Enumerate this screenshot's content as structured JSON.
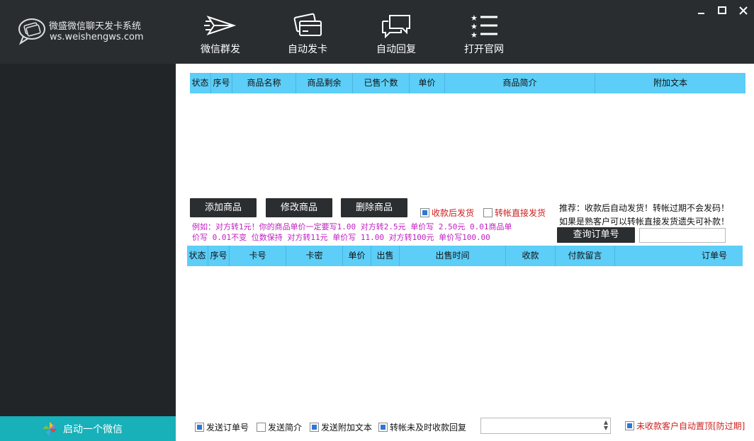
{
  "app": {
    "title": "微盛微信聊天发卡系统",
    "url": "ws.weishengws.com"
  },
  "nav": [
    {
      "label": "微信群发",
      "icon": "send-icon"
    },
    {
      "label": "自动发卡",
      "icon": "card-icon"
    },
    {
      "label": "自动回复",
      "icon": "chat-bubbles-icon"
    },
    {
      "label": "打开官网",
      "icon": "star-list-icon"
    }
  ],
  "window": {
    "min_icon": "minimize-icon",
    "max_icon": "maximize-icon",
    "close_icon": "close-icon"
  },
  "products": {
    "columns": [
      "状态",
      "序号",
      "商品名称",
      "商品剩余",
      "已售个数",
      "单价",
      "商品简介",
      "附加文本"
    ],
    "rows": []
  },
  "actions": {
    "add": "添加商品",
    "edit": "修改商品",
    "delete": "删除商品"
  },
  "options": {
    "after_payment": {
      "label": "收款后发货",
      "checked": true
    },
    "transfer_direct": {
      "label": "转帐直接发货",
      "checked": false
    }
  },
  "recommend": {
    "line1": "推荐：收款后自动发货！转帐过期不会发码！",
    "line2": "如果是熟客户可以转帐直接发货遗失可补款！"
  },
  "example": {
    "line1": "例如：对方转1元！你的商品单价一定要写1.00 对方转2.5元 单价写 2.50元 0.01商品单",
    "line2": "价写 0.01不变 位数保持 对方转11元 单价写 11.00  对方转100元 单价写100.00"
  },
  "query": {
    "button": "查询订单号",
    "value": ""
  },
  "orders": {
    "columns": [
      "状态",
      "序号",
      "卡号",
      "卡密",
      "单价",
      "出售",
      "出售时间",
      "收款",
      "付款留言",
      "订单号"
    ],
    "rows": []
  },
  "bottom": {
    "send_order": {
      "label": "发送订单号",
      "checked": true
    },
    "send_intro": {
      "label": "发送简介",
      "checked": false
    },
    "send_extra": {
      "label": "发送附加文本",
      "checked": true
    },
    "late_reply": {
      "label": "转帐未及时收款回复",
      "checked": true
    },
    "reply_value": "",
    "auto_top": {
      "label": "未收款客户自动置顶[防过期]",
      "checked": true
    }
  },
  "sidebar": {
    "start_button": "启动一个微信",
    "start_icon": "pinwheel-icon"
  },
  "colors": {
    "topbar": "#2a2d30",
    "sidebar": "#222527",
    "header": "#5ccef8",
    "accent": "#18b0b9",
    "warning": "#cc1f1f",
    "example_text": "#c01ec0"
  }
}
